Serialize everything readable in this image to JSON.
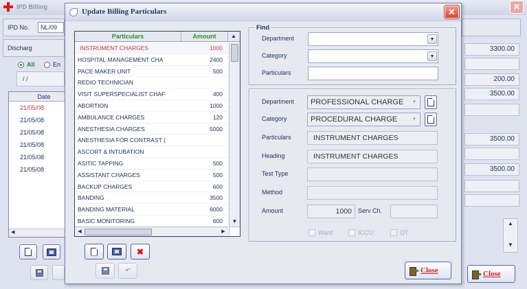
{
  "background": {
    "title": "IPD Billing",
    "ipd_no_label": "IPD No.",
    "ipd_no_value": "NL/09",
    "discharge_label": "Discharg",
    "filter_all": "All",
    "filter_other": "En",
    "date_placeholder": "/ /",
    "date_header": "Date",
    "dates": [
      "21/05/08",
      "21/05/08",
      "21/05/08",
      "21/05/08",
      "21/05/08",
      "21/05/08"
    ],
    "amounts": [
      "3300.00",
      "",
      "200.00",
      "3500.00",
      "",
      "3500.00",
      "",
      "3500.00"
    ],
    "close_label": "Close"
  },
  "dialog": {
    "title": "Update Billing Particulars",
    "grid": {
      "col_particulars": "Particulars",
      "col_amount": "Amount",
      "rows": [
        {
          "particular": "INSTRUMENT CHARGES",
          "amount": "1000"
        },
        {
          "particular": "HOSPITAL MANAGEMENT CHA",
          "amount": "2400"
        },
        {
          "particular": "PACE MAKER UNIT",
          "amount": "500"
        },
        {
          "particular": "REDIO TECHNICIAN",
          "amount": ""
        },
        {
          "particular": "VISIT SUPERSPECIALIST  CHAF",
          "amount": "400"
        },
        {
          "particular": "ABORTION",
          "amount": "1000"
        },
        {
          "particular": "AMBULANCE CHARGES",
          "amount": "120"
        },
        {
          "particular": "ANESTHESIA CHARGES",
          "amount": "5000"
        },
        {
          "particular": "ANESTHESIA FOR CONTRAST (",
          "amount": ""
        },
        {
          "particular": "ASCORT & INTUBATION",
          "amount": ""
        },
        {
          "particular": "ASITIC TAPPING",
          "amount": "500"
        },
        {
          "particular": "ASSISTANT CHARGES",
          "amount": "500"
        },
        {
          "particular": "BACKUP CHARGES",
          "amount": "600"
        },
        {
          "particular": "BANDING",
          "amount": "3500"
        },
        {
          "particular": "BANDING MATERIAL",
          "amount": "6000"
        },
        {
          "particular": "BASIC MONITORING",
          "amount": "600"
        }
      ]
    },
    "find": {
      "legend": "Find",
      "department_label": "Department",
      "category_label": "Category",
      "particulars_label": "Particulars",
      "department_value": "",
      "category_value": "",
      "particulars_value": ""
    },
    "detail": {
      "department_label": "Department",
      "department_value": "PROFESSIONAL CHARGE",
      "category_label": "Category",
      "category_value": "PROCEDURAL CHARGE",
      "particulars_label": "Particulars",
      "particulars_value": "INSTRUMENT CHARGES",
      "heading_label": "Heading",
      "heading_value": "INSTRUMENT CHARGES",
      "testtype_label": "Test Type",
      "testtype_value": "",
      "method_label": "Method",
      "method_value": "",
      "amount_label": "Amount",
      "amount_value": "1000",
      "servch_label": "Serv Ch.",
      "servch_value": "",
      "check_ward": "Ward",
      "check_iccu": "ICCU",
      "check_ot": "OT"
    },
    "close_label": "Close"
  }
}
